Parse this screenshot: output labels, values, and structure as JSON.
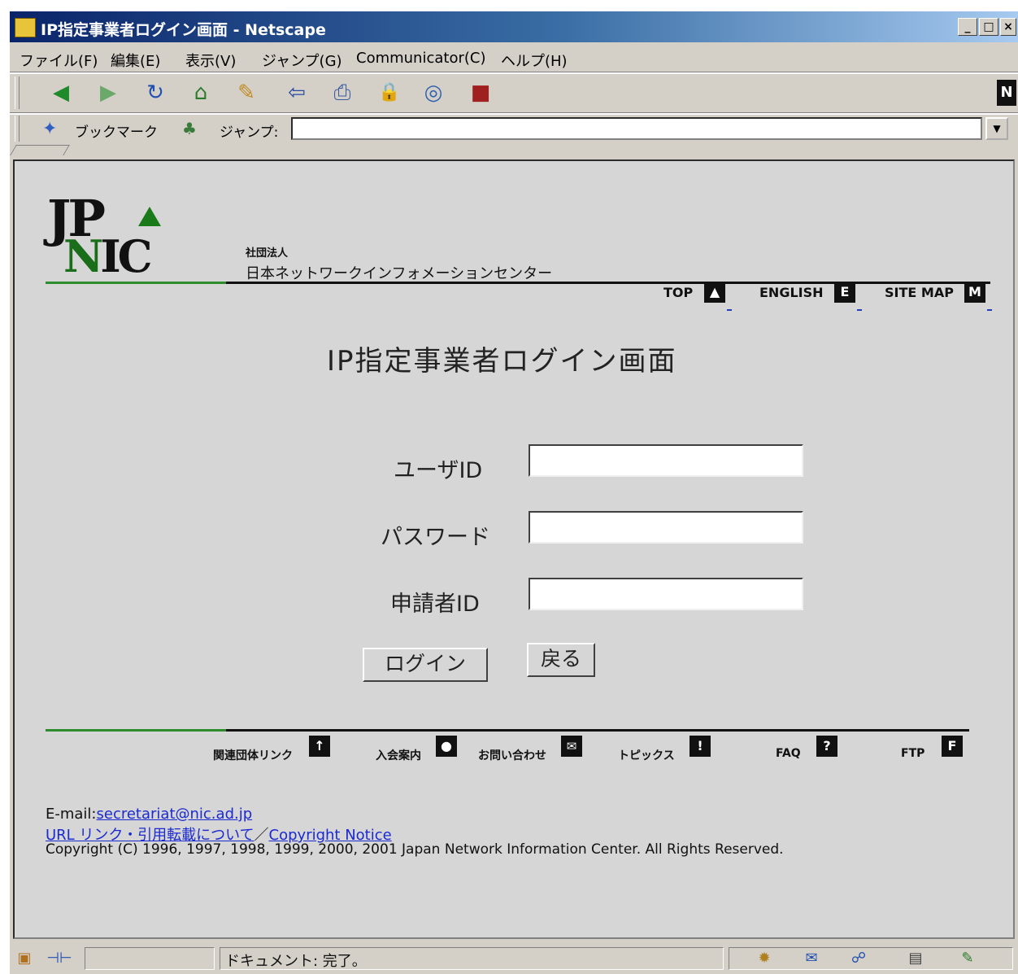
{
  "window": {
    "title": "IP指定事業者ログイン画面 - Netscape",
    "minimize": "_",
    "maximize": "□",
    "close": "×"
  },
  "menu": [
    "ファイル(F)",
    "編集(E)",
    "表示(V)",
    "ジャンプ(G)",
    "Communicator(C)",
    "ヘルプ(H)"
  ],
  "toolbar": {
    "icons": [
      "back-icon",
      "forward-icon",
      "reload-icon",
      "home-icon",
      "search-icon",
      "guide-icon",
      "print-icon",
      "security-icon",
      "shop-icon",
      "stop-icon"
    ],
    "glyphs": [
      "◀",
      "▶",
      "↻",
      "⌂",
      "✎",
      "⇦",
      "⎙",
      "🔒",
      "◎",
      "■"
    ]
  },
  "location": {
    "bookmark_label": "ブックマーク",
    "jump_label": "ジャンプ:",
    "url": ""
  },
  "page": {
    "org_type": "社団法人",
    "org_name": "日本ネットワークインフォメーションセンター",
    "logo_jp": "JP",
    "logo_n": "N",
    "logo_ic": "IC",
    "top_nav": [
      {
        "label": "TOP",
        "icon": "▲"
      },
      {
        "label": "ENGLISH",
        "icon": "E"
      },
      {
        "label": "SITE MAP",
        "icon": "M"
      }
    ],
    "title": "IP指定事業者ログイン画面",
    "fields": [
      {
        "label": "ユーザID",
        "value": ""
      },
      {
        "label": "パスワード",
        "value": ""
      },
      {
        "label": "申請者ID",
        "value": ""
      }
    ],
    "login_button": "ログイン",
    "back_button": "戻る",
    "bottom_nav": [
      {
        "label": "関連団体リンク",
        "icon": "↑"
      },
      {
        "label": "入会案内",
        "icon": "●"
      },
      {
        "label": "お問い合わせ",
        "icon": "✉"
      },
      {
        "label": "トピックス",
        "icon": "!"
      },
      {
        "label": "FAQ",
        "icon": "?"
      },
      {
        "label": "FTP",
        "icon": "F"
      }
    ],
    "footer": {
      "email_prefix": "E-mail:",
      "email": "secretariat@nic.ad.jp",
      "url_link": "URL リンク・引用転載について",
      "divider": "／",
      "copyright_link": "Copyright Notice",
      "copyright": "Copyright (C) 1996, 1997, 1998, 1999, 2000, 2001 Japan Network Information Center. All Rights Reserved."
    }
  },
  "status": {
    "text": "ドキュメント: 完了。"
  }
}
